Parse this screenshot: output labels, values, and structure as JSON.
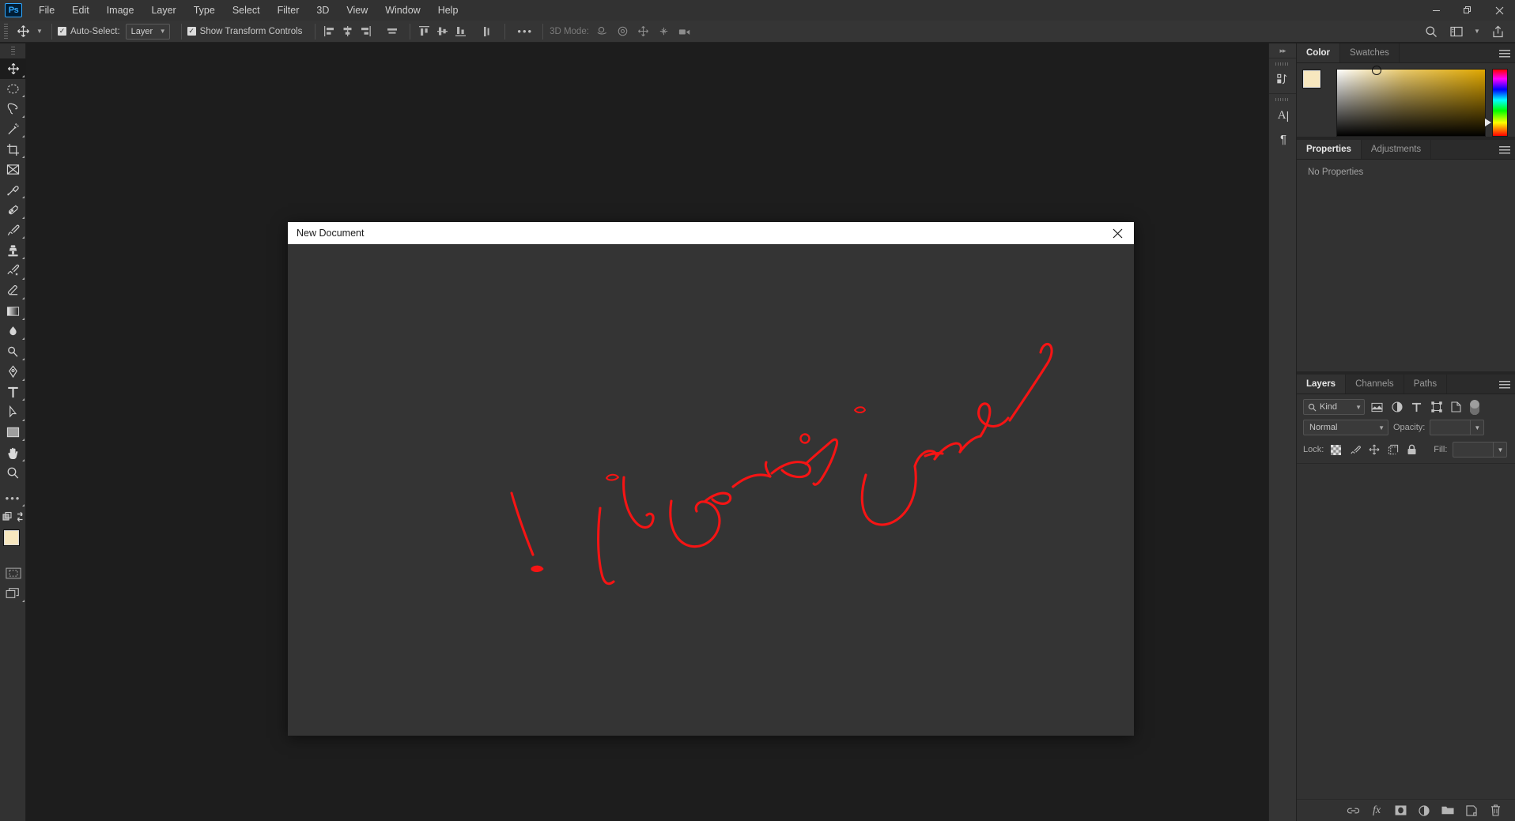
{
  "app": {
    "name": "Adobe Photoshop",
    "logo_text": "Ps",
    "accent": "#31a8ff"
  },
  "menubar": {
    "items": [
      {
        "label": "File"
      },
      {
        "label": "Edit"
      },
      {
        "label": "Image"
      },
      {
        "label": "Layer"
      },
      {
        "label": "Type"
      },
      {
        "label": "Select"
      },
      {
        "label": "Filter"
      },
      {
        "label": "3D"
      },
      {
        "label": "View"
      },
      {
        "label": "Window"
      },
      {
        "label": "Help"
      }
    ]
  },
  "window_controls": {
    "minimize": "—",
    "maximize": "❐",
    "close": "✕"
  },
  "options_bar": {
    "tool_icon": "move-tool",
    "auto_select_label": "Auto-Select:",
    "auto_select_checked": true,
    "auto_select_value": "Layer",
    "show_transform_label": "Show Transform Controls",
    "show_transform_checked": true,
    "align_horizontal": [
      "align-left-edges",
      "align-horizontal-centers",
      "align-right-edges",
      "distribute-horizontal"
    ],
    "align_vertical": [
      "align-top-edges",
      "align-vertical-centers",
      "align-bottom-edges",
      "distribute-vertical"
    ],
    "more_label": "•••",
    "mode3d_label": "3D Mode:",
    "mode3d_icons": [
      "orbit-3d",
      "roll-3d",
      "pan-3d",
      "slide-3d",
      "camera-3d"
    ],
    "right_icons": [
      "search-icon",
      "workspace-icon",
      "chevron-down-icon",
      "share-icon"
    ]
  },
  "toolbar": {
    "tools": [
      {
        "name": "move-tool",
        "glyph": "move",
        "active": true,
        "has_flyout": true
      },
      {
        "name": "marquee-tool",
        "glyph": "ellipse-marquee",
        "active": false,
        "has_flyout": true
      },
      {
        "name": "lasso-tool",
        "glyph": "lasso",
        "active": false,
        "has_flyout": true
      },
      {
        "name": "magic-wand-tool",
        "glyph": "wand",
        "active": false,
        "has_flyout": true
      },
      {
        "name": "crop-tool",
        "glyph": "crop",
        "active": false,
        "has_flyout": true
      },
      {
        "name": "frame-tool",
        "glyph": "frame",
        "active": false,
        "has_flyout": false
      },
      {
        "name": "eyedropper-tool",
        "glyph": "eyedropper",
        "active": false,
        "has_flyout": true
      },
      {
        "name": "healing-brush-tool",
        "glyph": "healing",
        "active": false,
        "has_flyout": true
      },
      {
        "name": "brush-tool",
        "glyph": "brush",
        "active": false,
        "has_flyout": true
      },
      {
        "name": "clone-stamp-tool",
        "glyph": "stamp",
        "active": false,
        "has_flyout": true
      },
      {
        "name": "history-brush-tool",
        "glyph": "history-brush",
        "active": false,
        "has_flyout": true
      },
      {
        "name": "eraser-tool",
        "glyph": "eraser",
        "active": false,
        "has_flyout": true
      },
      {
        "name": "gradient-tool",
        "glyph": "gradient",
        "active": false,
        "has_flyout": true
      },
      {
        "name": "blur-tool",
        "glyph": "blur",
        "active": false,
        "has_flyout": true
      },
      {
        "name": "dodge-tool",
        "glyph": "dodge",
        "active": false,
        "has_flyout": true
      },
      {
        "name": "pen-tool",
        "glyph": "pen",
        "active": false,
        "has_flyout": true
      },
      {
        "name": "type-tool",
        "glyph": "type",
        "active": false,
        "has_flyout": true
      },
      {
        "name": "path-selection-tool",
        "glyph": "path-arrow",
        "active": false,
        "has_flyout": true
      },
      {
        "name": "rectangle-tool",
        "glyph": "rectangle",
        "active": false,
        "has_flyout": true
      },
      {
        "name": "hand-tool",
        "glyph": "hand",
        "active": false,
        "has_flyout": true
      },
      {
        "name": "zoom-tool",
        "glyph": "zoom",
        "active": false,
        "has_flyout": false
      }
    ],
    "more_tools_label": "•••",
    "foreground_color": "#f7e7bf",
    "background_color": "#ffffff",
    "quick_mask_name": "quick-mask-mode",
    "screen_mode_name": "screen-mode"
  },
  "workspace_strip": {
    "collapse_label": "▸▸",
    "icons": [
      {
        "name": "history-panel-icon",
        "glyph": "history"
      },
      {
        "name": "character-panel-icon",
        "glyph": "A|"
      },
      {
        "name": "paragraph-panel-icon",
        "glyph": "¶"
      }
    ]
  },
  "color_panel": {
    "tabs": [
      {
        "label": "Color",
        "active": true
      },
      {
        "label": "Swatches",
        "active": false
      }
    ],
    "foreground_color": "#f7e7bf",
    "background_color": "#ffffff",
    "ramp_base_hue": "#e0a800",
    "menu_icon": "panel-menu-icon"
  },
  "properties_panel": {
    "tabs": [
      {
        "label": "Properties",
        "active": true
      },
      {
        "label": "Adjustments",
        "active": false
      }
    ],
    "empty_text": "No Properties",
    "menu_icon": "panel-menu-icon"
  },
  "layers_panel": {
    "tabs": [
      {
        "label": "Layers",
        "active": true
      },
      {
        "label": "Channels",
        "active": false
      },
      {
        "label": "Paths",
        "active": false
      }
    ],
    "menu_icon": "panel-menu-icon",
    "filter_label": "Kind",
    "filter_icons": [
      "pixel-filter-icon",
      "adjustment-filter-icon",
      "type-filter-icon",
      "shape-filter-icon",
      "smart-object-filter-icon"
    ],
    "filter_toggle_name": "filter-enable-toggle",
    "blend_mode": "Normal",
    "opacity_label": "Opacity:",
    "opacity_value": "",
    "lock_label": "Lock:",
    "lock_icons": [
      "lock-transparent-pixels-icon",
      "lock-image-pixels-icon",
      "lock-position-icon",
      "lock-artboard-icon",
      "lock-all-icon"
    ],
    "fill_label": "Fill:",
    "fill_value": "",
    "bottom_icons": [
      {
        "name": "link-layers-icon",
        "glyph": "link"
      },
      {
        "name": "layer-style-icon",
        "glyph": "fx"
      },
      {
        "name": "layer-mask-icon",
        "glyph": "mask"
      },
      {
        "name": "adjustment-layer-icon",
        "glyph": "half-circle"
      },
      {
        "name": "new-group-icon",
        "glyph": "folder"
      },
      {
        "name": "new-layer-icon",
        "glyph": "new-page"
      },
      {
        "name": "delete-layer-icon",
        "glyph": "trash"
      }
    ]
  },
  "dialog": {
    "title": "New Document",
    "close_label": "✕",
    "annotation": {
      "description": "Red handwritten Persian annotation drawn over the dialog",
      "color": "#f61414"
    }
  }
}
